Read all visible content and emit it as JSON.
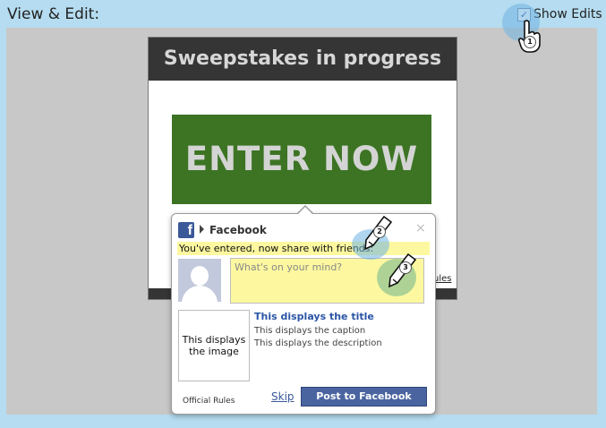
{
  "header": {
    "title": "View & Edit:",
    "show_edits_label": "Show Edits",
    "show_edits_checked": "✓"
  },
  "panel": {
    "heading": "Sweepstakes in progress",
    "enter_label": "ENTER NOW",
    "rules_tail": "ules"
  },
  "popup": {
    "brand": "Facebook",
    "close": "×",
    "shared_message": "You've entered, now share with friends:",
    "message_placeholder": "What's on your mind?",
    "image_placeholder": "This displays the image",
    "link_title": "This displays the title",
    "link_caption": "This displays the caption",
    "link_description": "This displays the description",
    "official_rules": "Official Rules",
    "skip": "Skip",
    "post_button": "Post to Facebook"
  },
  "markers": [
    "1",
    "2",
    "3"
  ],
  "colors": {
    "page_bg": "#b5dcf0",
    "enter_green": "#3c7423",
    "facebook_blue": "#3b5998",
    "highlight_yellow": "#fdf8a0"
  },
  "icons": [
    "checkbox-icon",
    "hand-cursor-icon",
    "facebook-logo-icon",
    "pencil-icon",
    "close-icon",
    "caret-right-icon"
  ]
}
